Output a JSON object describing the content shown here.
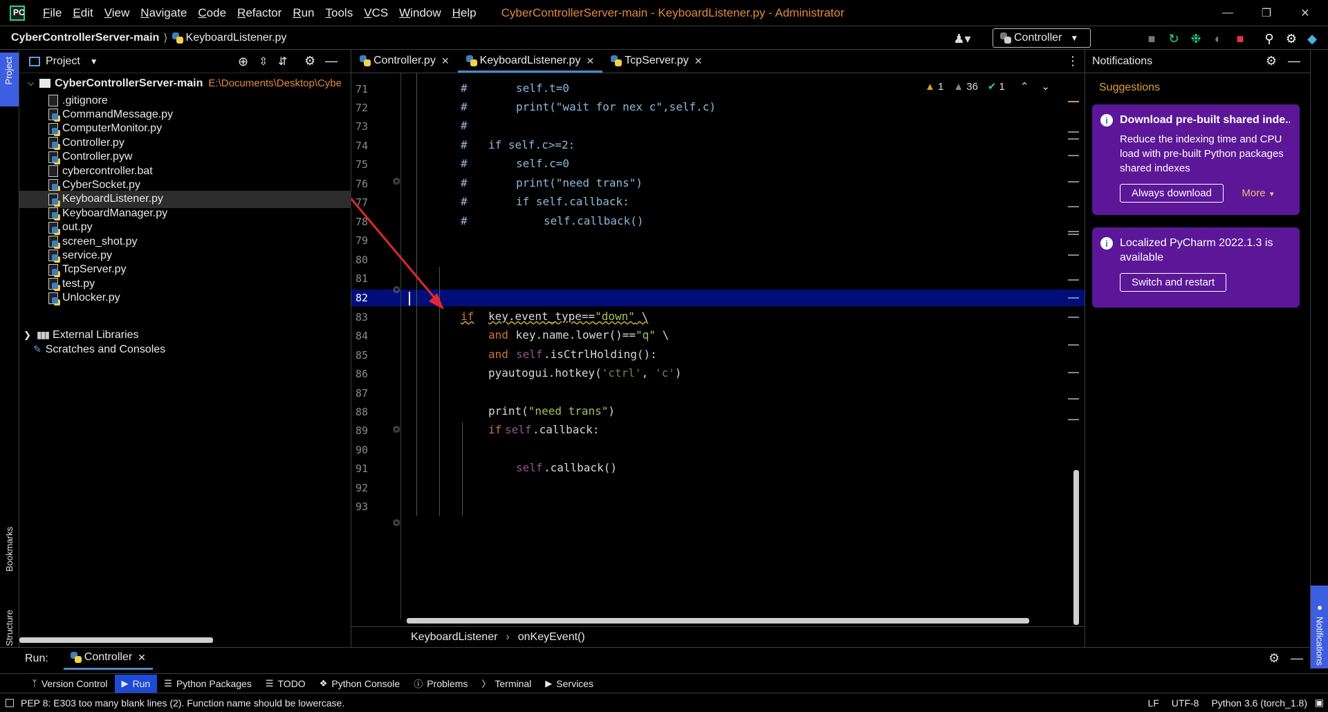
{
  "titlebar": {
    "menu": [
      "File",
      "Edit",
      "View",
      "Navigate",
      "Code",
      "Refactor",
      "Run",
      "Tools",
      "VCS",
      "Window",
      "Help"
    ],
    "window_title": "CyberControllerServer-main - KeyboardListener.py - Administrator"
  },
  "navbar": {
    "project": "CyberControllerServer-main",
    "file": "KeyboardListener.py",
    "run_config": "Controller"
  },
  "left_strip": {
    "project": "Project",
    "bookmarks": "Bookmarks",
    "structure": "Structure"
  },
  "project_panel": {
    "title": "Project",
    "root_name": "CyberControllerServer-main",
    "root_path": "E:\\Documents\\Desktop\\Cybe",
    "files": [
      ".gitignore",
      "CommandMessage.py",
      "ComputerMonitor.py",
      "Controller.py",
      "Controller.pyw",
      "cybercontroller.bat",
      "CyberSocket.py",
      "KeyboardListener.py",
      "KeyboardManager.py",
      "out.py",
      "screen_shot.py",
      "service.py",
      "TcpServer.py",
      "test.py",
      "Unlocker.py"
    ],
    "external_libraries": "External Libraries",
    "scratches": "Scratches and Consoles"
  },
  "editor": {
    "tabs": [
      "Controller.py",
      "KeyboardListener.py",
      "TcpServer.py"
    ],
    "line_numbers": [
      "71",
      "72",
      "73",
      "74",
      "75",
      "76",
      "77",
      "78",
      "79",
      "80",
      "81",
      "82",
      "83",
      "84",
      "85",
      "86",
      "87",
      "88",
      "89",
      "90",
      "91",
      "92",
      "93"
    ],
    "inspection": {
      "warnings": "1",
      "weak_warnings": "36",
      "ok": "1"
    },
    "breadcrumb": {
      "class": "KeyboardListener",
      "method": "onKeyEvent()"
    },
    "code": {
      "l71_hash": "#",
      "l71": "self.t=0",
      "l72_hash": "#",
      "l72": "print(\"wait for nex c\",self.c)",
      "l73_hash": "#",
      "l74_hash": "#",
      "l74": "if self.c>=2:",
      "l75_hash": "#",
      "l75": "self.c=0",
      "l76_hash": "#",
      "l76": "print(\"need trans\")",
      "l77_hash": "#",
      "l77": "if self.callback:",
      "l78_hash": "#",
      "l78": "self.callback()",
      "l83_kw": "if",
      "l83_a": "key.event_type==",
      "l83_s": "\"down\"",
      "l83_b": " \\",
      "l84_kw": "and",
      "l84_a": " key.name.lower()==",
      "l84_s": "\"q\"",
      "l84_b": " \\",
      "l85_kw": "and",
      "l85_self": "self",
      "l85_a": ".isCtrlHolding():",
      "l86_a": "pyautogui.hotkey(",
      "l86_s1": "'ctrl'",
      "l86_c": ", ",
      "l86_s2": "'c'",
      "l86_b": ")",
      "l88_a": "print(",
      "l88_s": "\"need trans\"",
      "l88_b": ")",
      "l89_kw": "if",
      "l89_self": "self",
      "l89_a": ".callback:",
      "l91_self": "self",
      "l91_a": ".callback()"
    }
  },
  "notifications": {
    "title": "Notifications",
    "suggestions": "Suggestions",
    "card1": {
      "title": "Download pre-built shared inde...",
      "body": "Reduce the indexing time and CPU load with pre-built Python packages shared indexes",
      "button": "Always download",
      "more": "More"
    },
    "card2": {
      "title": "Localized PyCharm 2022.1.3 is available",
      "button": "Switch and restart"
    },
    "vtab": "Notifications"
  },
  "run_bar": {
    "label": "Run:",
    "tab": "Controller"
  },
  "tool_windows": [
    "Version Control",
    "Run",
    "Python Packages",
    "TODO",
    "Python Console",
    "Problems",
    "Terminal",
    "Services"
  ],
  "status": {
    "message": "PEP 8: E303 too many blank lines (2). Function name should be lowercase.",
    "line_sep": "LF",
    "encoding": "UTF-8",
    "interpreter": "Python 3.6 (torch_1.8)"
  },
  "colors": {
    "accent": "#4a88c7",
    "notification_card": "#5b1797",
    "current_line": "#000e7a",
    "title": "#e08a3c"
  }
}
